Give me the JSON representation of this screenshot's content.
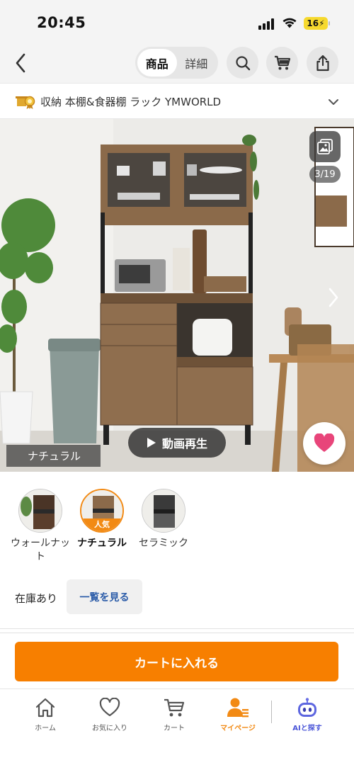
{
  "status_bar": {
    "time": "20:45",
    "battery": "16"
  },
  "nav": {
    "segments": [
      {
        "label": "商品",
        "active": true
      },
      {
        "label": "詳細",
        "active": false
      }
    ]
  },
  "store": {
    "name": "収納 本棚&食器棚 ラック YMWORLD"
  },
  "image": {
    "counter": "3/19",
    "video_label": "動画再生",
    "variant_label": "ナチュラル"
  },
  "variants": [
    {
      "name": "ウォールナット",
      "selected": false,
      "tag": ""
    },
    {
      "name": "ナチュラル",
      "selected": true,
      "tag": "人気"
    },
    {
      "name": "セラミック",
      "selected": false,
      "tag": ""
    }
  ],
  "stock": {
    "label": "在庫あり",
    "list_button": "一覧を見る"
  },
  "cart": {
    "label": "カートに入れる"
  },
  "tabs": [
    {
      "label": "ホーム",
      "icon": "home-icon"
    },
    {
      "label": "お気に入り",
      "icon": "heart-icon"
    },
    {
      "label": "カート",
      "icon": "cart-icon"
    },
    {
      "label": "マイページ",
      "icon": "mypage-icon",
      "active": true
    },
    {
      "label": "AIと探す",
      "icon": "ai-robot-icon"
    }
  ],
  "colors": {
    "accent": "#f77f00",
    "link": "#2a5ba8",
    "favorite": "#e8457a",
    "ai": "#4a55d8"
  }
}
